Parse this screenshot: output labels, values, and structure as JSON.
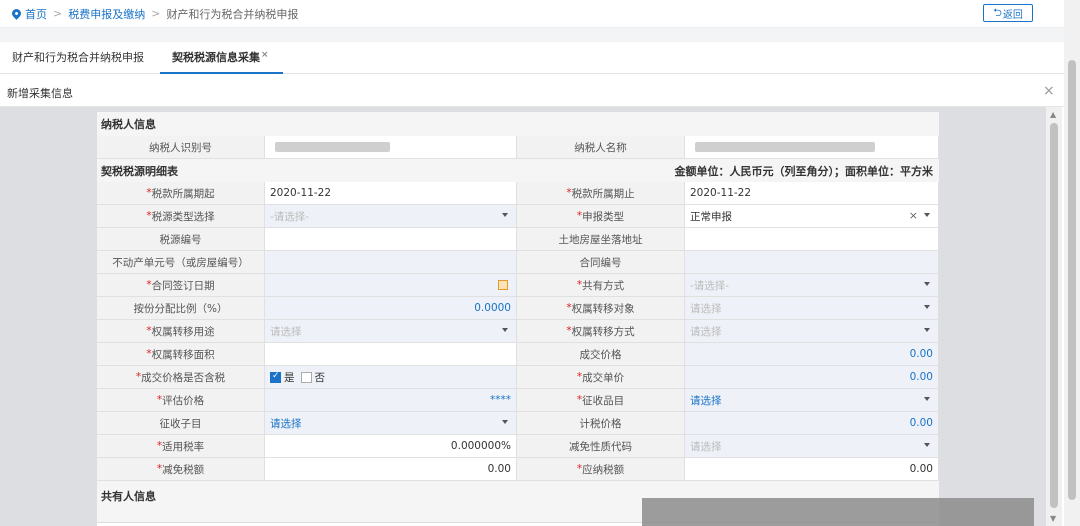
{
  "breadcrumb": {
    "home": "首页",
    "level1": "税费申报及缴纳",
    "current": "财产和行为税合并纳税申报",
    "sep": ">"
  },
  "back_button": "返回",
  "tabs": [
    {
      "label": "财产和行为税合并纳税申报"
    },
    {
      "label": "契税税源信息采集",
      "close": "×"
    }
  ],
  "dialog": {
    "title": "新增采集信息",
    "close": "×"
  },
  "sections": {
    "taxpayer": "纳税人信息",
    "detail": "契税税源明细表",
    "unit": "金额单位：人民币元（列至角分）；面积单位：平方米",
    "owners": "共有人信息"
  },
  "taxpayer": {
    "id_label": "纳税人识别号",
    "name_label": "纳税人名称"
  },
  "form": {
    "period_start_label": "税款所属期起",
    "period_start": "2020-11-22",
    "period_end_label": "税款所属期止",
    "period_end": "2020-11-22",
    "source_type_label": "税源类型选择",
    "source_type_ph": "-请选择-",
    "decl_type_label": "申报类型",
    "decl_type": "正常申报",
    "source_no_label": "税源编号",
    "address_label": "土地房屋坐落地址",
    "unit_no_label": "不动产单元号（或房屋编号）",
    "contract_no_label": "合同编号",
    "sign_date_label": "合同签订日期",
    "share_way_label": "共有方式",
    "share_way_ph": "-请选择-",
    "ratio_label": "按份分配比例（%）",
    "ratio": "0.0000",
    "transfer_obj_label": "权属转移对象",
    "transfer_obj_ph": "请选择",
    "usage_label": "权属转移用途",
    "usage_ph": "请选择",
    "transfer_way_label": "权属转移方式",
    "transfer_way_ph": "请选择",
    "area_label": "权属转移面积",
    "deal_price_label": "成交价格",
    "deal_price": "0.00",
    "tax_incl_label": "成交价格是否含税",
    "yes": "是",
    "no": "否",
    "unit_price_label": "成交单价",
    "unit_price": "0.00",
    "eval_label": "评估价格",
    "eval": "****",
    "item_label": "征收品目",
    "item_ph": "请选择",
    "subitem_label": "征收子目",
    "subitem_ph": "请选择",
    "taxbase_label": "计税价格",
    "taxbase": "0.00",
    "rate_label": "适用税率",
    "rate": "0.000000%",
    "relief_code_label": "减免性质代码",
    "relief_code_ph": "请选择",
    "relief_amt_label": "减免税额",
    "relief_amt": "0.00",
    "payable_label": "应纳税额",
    "payable": "0.00"
  }
}
